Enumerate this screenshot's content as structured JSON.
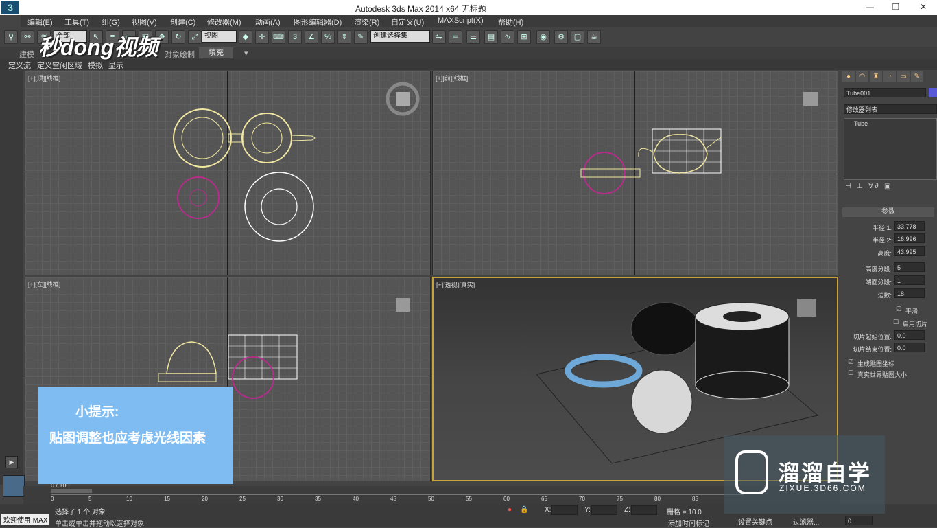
{
  "window": {
    "title": "Autodesk 3ds Max  2014 x64      无标题",
    "min": "—",
    "max": "❐",
    "close": "✕"
  },
  "menu": [
    "编辑(E)",
    "工具(T)",
    "组(G)",
    "视图(V)",
    "创建(C)",
    "修改器(M)",
    "动画(A)",
    "图形编辑器(D)",
    "渲染(R)",
    "自定义(U)",
    "MAXScript(X)",
    "帮助(H)"
  ],
  "toolbar": {
    "filter": "全部",
    "refcoord": "视图",
    "selset": "创建选择集"
  },
  "ribbon": {
    "tabs": [
      "建模",
      "自由形式",
      "选择",
      "对象绘制",
      "填充"
    ],
    "active": "填充"
  },
  "subtabs": [
    "定义流",
    "定义空闲区域",
    "模拟",
    "显示"
  ],
  "brand": "秒dong视频",
  "viewports": {
    "top": "[+][顶][线框]",
    "front": "[+][前][线框]",
    "left": "[+][左][线框]",
    "persp": "[+][透视][真实]"
  },
  "cmd": {
    "name": "Tube001",
    "modlist": "修改器列表",
    "stack_item": "Tube",
    "rollout": "参数",
    "params": [
      {
        "label": "半径 1:",
        "value": "33.778"
      },
      {
        "label": "半径 2:",
        "value": "16.996"
      },
      {
        "label": "高度:",
        "value": "43.995"
      },
      {
        "label": "高度分段:",
        "value": "5"
      },
      {
        "label": "端面分段:",
        "value": "1"
      },
      {
        "label": "边数:",
        "value": "18"
      }
    ],
    "smooth": "平滑",
    "slice_on": "启用切片",
    "slice_from": {
      "label": "切片起始位置:",
      "value": "0.0"
    },
    "slice_to": {
      "label": "切片结束位置:",
      "value": "0.0"
    },
    "gen_map": "生成贴图坐标",
    "real_map": "真实世界贴图大小"
  },
  "timeline": {
    "frame": "0 / 100",
    "ticks": [
      "0",
      "5",
      "10",
      "15",
      "20",
      "25",
      "30",
      "35",
      "40",
      "45",
      "50",
      "55",
      "60",
      "65",
      "70",
      "75",
      "80",
      "85"
    ]
  },
  "status": {
    "welcome": "欢迎使用 MAX",
    "selected": "选择了 1 个 对象",
    "hint": "单击或单击并拖动以选择对象",
    "x": "X:",
    "y": "Y:",
    "z": "Z:",
    "grid": "栅格 = 10.0",
    "addtime": "添加时间标记",
    "setkey": "设置关键点",
    "filters": "过滤器...",
    "framefield": "0"
  },
  "tip": {
    "heading": "小提示:",
    "body": "贴图调整也应考虑光线因素"
  },
  "watermark": {
    "cn": "溜溜自学",
    "en": "ZIXUE.3D66.COM"
  }
}
